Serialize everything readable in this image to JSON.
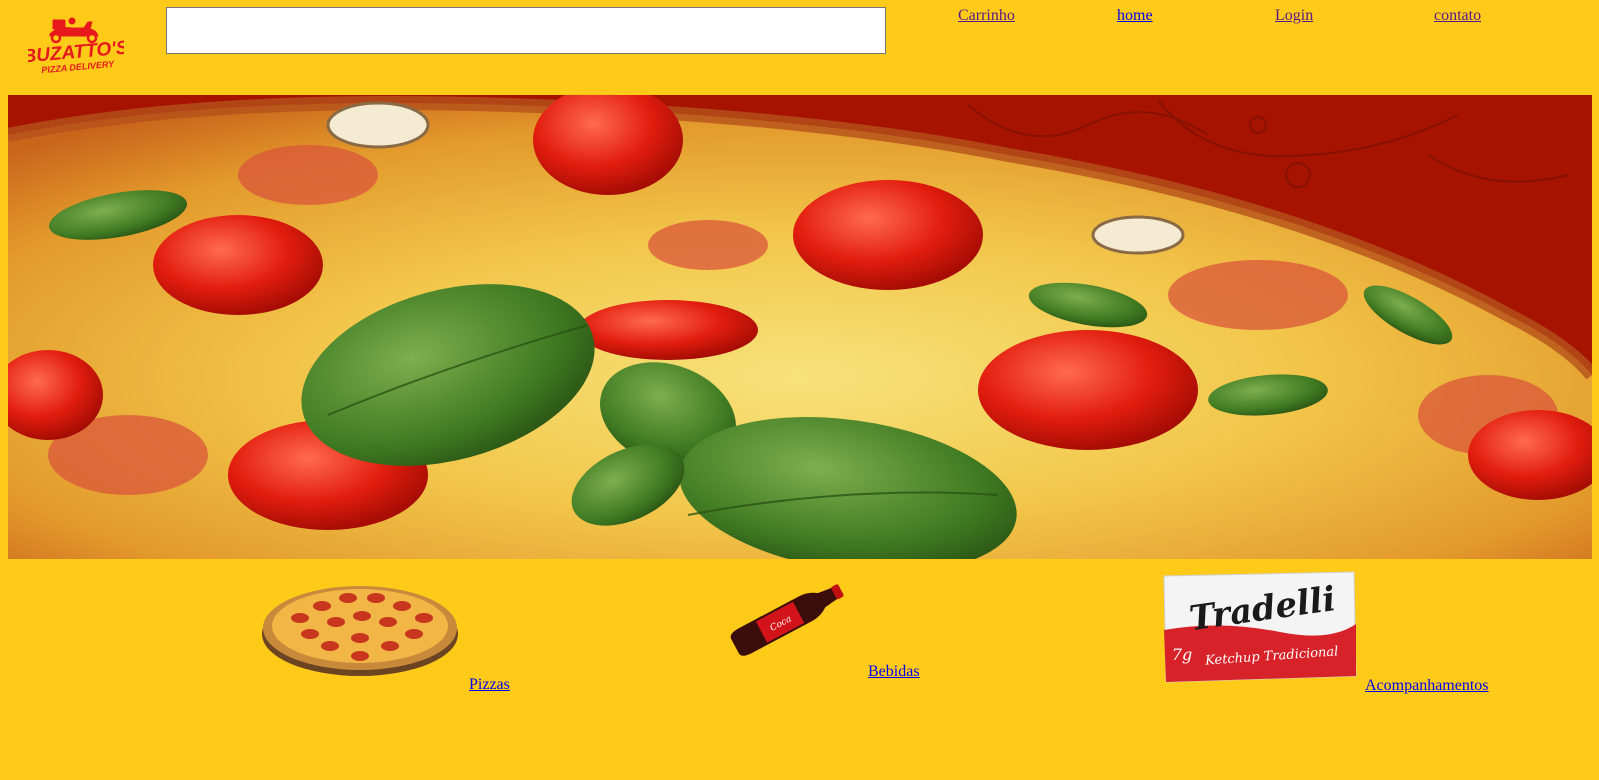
{
  "brand": {
    "name": "BUZATTO'S",
    "tagline": "PIZZA DELIVERY",
    "color": "#e8191d"
  },
  "search": {
    "value": "",
    "placeholder": ""
  },
  "nav": {
    "items": [
      {
        "label": "Carrinho",
        "state": "visited"
      },
      {
        "label": "home",
        "state": "unvisited"
      },
      {
        "label": "Login",
        "state": "visited"
      },
      {
        "label": "contato",
        "state": "visited"
      }
    ]
  },
  "hero": {
    "icon": "pizza-banner-photo",
    "background_color": "#a61400"
  },
  "categories": [
    {
      "label": "Pizzas",
      "icon": "pepperoni-pizza-image"
    },
    {
      "label": "Bebidas",
      "icon": "cola-bottle-image"
    },
    {
      "label": "Acompanhamentos",
      "icon": "ketchup-sachet-image",
      "product_text": "Tradelli",
      "product_subtext": "Ketchup Tradicional",
      "product_weight": "7g"
    }
  ],
  "colors": {
    "page_background": "#ffca18",
    "link_visited": "#551a8b",
    "link_unvisited": "#0000ee"
  }
}
